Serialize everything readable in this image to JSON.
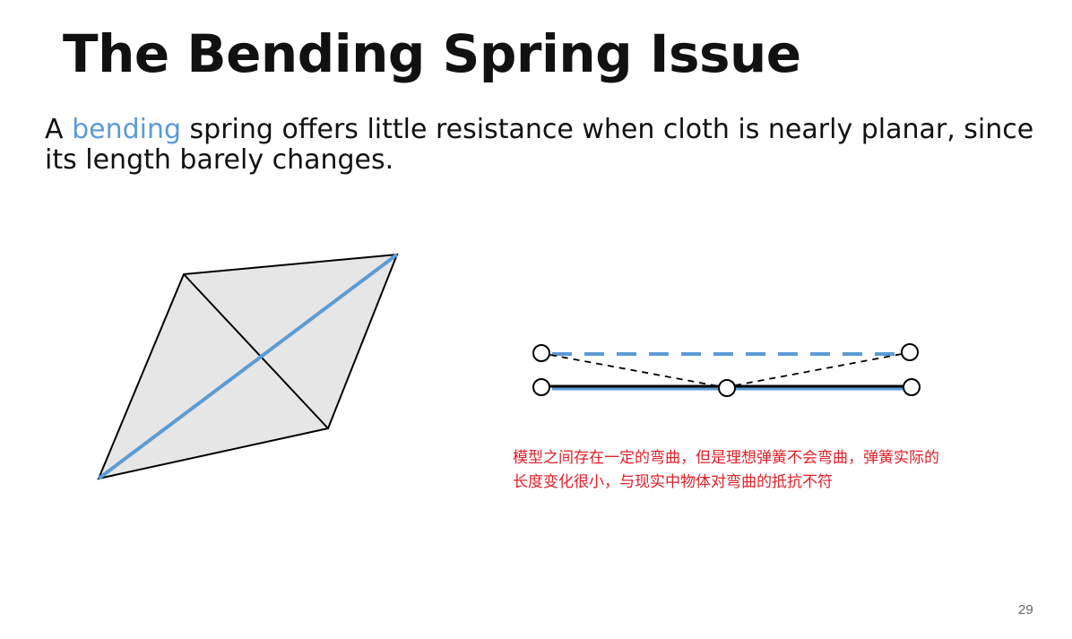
{
  "slide": {
    "title": "The Bending Spring Issue",
    "body_prefix": "A ",
    "body_keyword": "bending",
    "body_suffix": " spring offers little resistance when cloth is nearly planar, since its length barely changes.",
    "note": "模型之间存在一定的弯曲，但是理想弹簧不会弯曲，弹簧实际的长度变化很小，与现实中物体对弯曲的抵抗不符",
    "page_number": "29"
  },
  "colors": {
    "spring": "#5b9bd5",
    "cloth_fill": "#e6e6e6",
    "edge": "#000000",
    "note": "#e0202a"
  }
}
